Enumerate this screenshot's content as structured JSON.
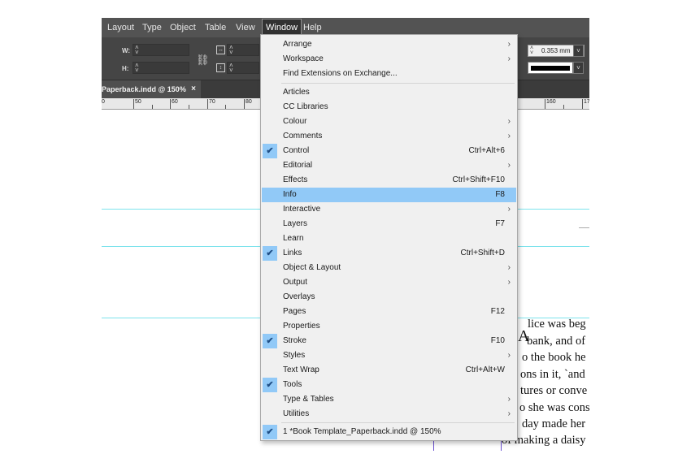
{
  "menubar": [
    "Layout",
    "Type",
    "Object",
    "Table",
    "View",
    "Window",
    "Help"
  ],
  "control": {
    "w_label": "W:",
    "h_label": "H:",
    "stroke_weight": "0.353 mm"
  },
  "tab": {
    "title": "Paperback.indd @ 150%",
    "close": "×"
  },
  "ruler": [
    "0",
    "50",
    "60",
    "70",
    "80",
    "160",
    "17"
  ],
  "page_text": [
    "lice was beg",
    "bank, and of",
    "o the book he",
    "ons in it, `and",
    "tures or conve",
    "o she was cons",
    "day made her",
    "of making a daisy"
  ],
  "dropcap": "A",
  "menu": {
    "group1": [
      {
        "label": "Arrange",
        "shortcut": "",
        "submenu": true,
        "checked": false
      },
      {
        "label": "Workspace",
        "shortcut": "",
        "submenu": true,
        "checked": false
      },
      {
        "label": "Find Extensions on Exchange...",
        "shortcut": "",
        "submenu": false,
        "checked": false
      }
    ],
    "group2": [
      {
        "label": "Articles",
        "shortcut": "",
        "submenu": false,
        "checked": false
      },
      {
        "label": "CC Libraries",
        "shortcut": "",
        "submenu": false,
        "checked": false
      },
      {
        "label": "Colour",
        "shortcut": "",
        "submenu": true,
        "checked": false
      },
      {
        "label": "Comments",
        "shortcut": "",
        "submenu": true,
        "checked": false
      },
      {
        "label": "Control",
        "shortcut": "Ctrl+Alt+6",
        "submenu": false,
        "checked": true
      },
      {
        "label": "Editorial",
        "shortcut": "",
        "submenu": true,
        "checked": false
      },
      {
        "label": "Effects",
        "shortcut": "Ctrl+Shift+F10",
        "submenu": false,
        "checked": false
      },
      {
        "label": "Info",
        "shortcut": "F8",
        "submenu": false,
        "checked": false,
        "highlighted": true
      },
      {
        "label": "Interactive",
        "shortcut": "",
        "submenu": true,
        "checked": false
      },
      {
        "label": "Layers",
        "shortcut": "F7",
        "submenu": false,
        "checked": false
      },
      {
        "label": "Learn",
        "shortcut": "",
        "submenu": false,
        "checked": false
      },
      {
        "label": "Links",
        "shortcut": "Ctrl+Shift+D",
        "submenu": false,
        "checked": true
      },
      {
        "label": "Object & Layout",
        "shortcut": "",
        "submenu": true,
        "checked": false
      },
      {
        "label": "Output",
        "shortcut": "",
        "submenu": true,
        "checked": false
      },
      {
        "label": "Overlays",
        "shortcut": "",
        "submenu": false,
        "checked": false
      },
      {
        "label": "Pages",
        "shortcut": "F12",
        "submenu": false,
        "checked": false
      },
      {
        "label": "Properties",
        "shortcut": "",
        "submenu": false,
        "checked": false
      },
      {
        "label": "Stroke",
        "shortcut": "F10",
        "submenu": false,
        "checked": true
      },
      {
        "label": "Styles",
        "shortcut": "",
        "submenu": true,
        "checked": false
      },
      {
        "label": "Text Wrap",
        "shortcut": "Ctrl+Alt+W",
        "submenu": false,
        "checked": false
      },
      {
        "label": "Tools",
        "shortcut": "",
        "submenu": false,
        "checked": true
      },
      {
        "label": "Type & Tables",
        "shortcut": "",
        "submenu": true,
        "checked": false
      },
      {
        "label": "Utilities",
        "shortcut": "",
        "submenu": true,
        "checked": false
      }
    ],
    "group3": [
      {
        "label": "1 *Book Template_Paperback.indd @ 150%",
        "shortcut": "",
        "submenu": false,
        "checked": true
      }
    ],
    "check_glyph": "✔",
    "submenu_glyph": "›"
  },
  "colors": {
    "highlight": "#91c9f7",
    "guide": "#7de3ec",
    "menubar": "#535353"
  }
}
